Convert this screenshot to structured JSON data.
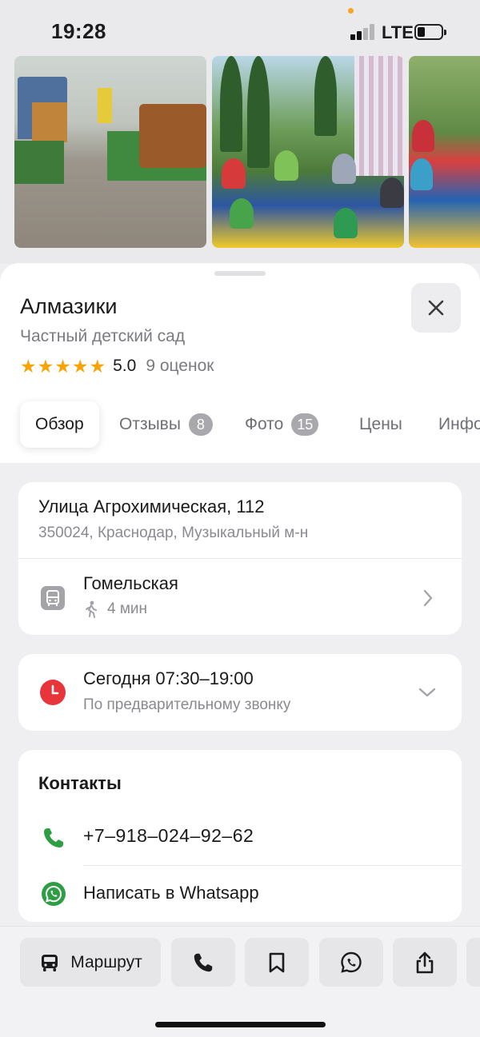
{
  "status_bar": {
    "time": "19:28",
    "network": "LTE"
  },
  "place": {
    "name": "Алмазики",
    "category": "Частный детский сад",
    "stars": "★★★★★",
    "rating": "5.0",
    "reviews_count": "9 оценок"
  },
  "tabs": [
    {
      "label": "Обзор",
      "badge": ""
    },
    {
      "label": "Отзывы",
      "badge": "8"
    },
    {
      "label": "Фото",
      "badge": "15"
    },
    {
      "label": "Цены",
      "badge": ""
    },
    {
      "label": "Инфо",
      "badge": ""
    }
  ],
  "address": {
    "street": "Улица Агрохимическая, 112",
    "details": "350024, Краснодар, Музыкальный м-н"
  },
  "transit": {
    "stop": "Гомельская",
    "walk_time": "4 мин"
  },
  "hours": {
    "today": "Сегодня 07:30–19:00",
    "note": "По предварительному звонку"
  },
  "contacts": {
    "title": "Контакты",
    "phone": "+7‒918‒024‒92‒62",
    "whatsapp": "Написать в Whatsapp"
  },
  "actions": {
    "route_label": "Маршрут"
  },
  "colors": {
    "star": "#f5a50a",
    "clock": "#e8343b",
    "phone": "#2e9e45",
    "whatsapp": "#2e9e45"
  }
}
